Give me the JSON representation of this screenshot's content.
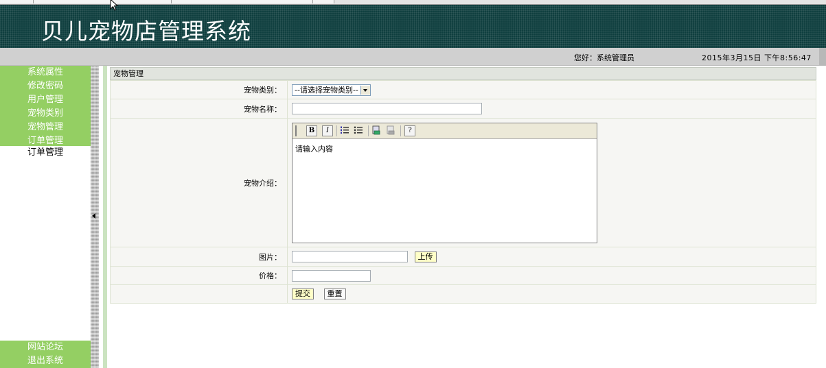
{
  "app": {
    "title": "贝儿宠物店管理系统"
  },
  "status": {
    "greeting": "您好：系统管理员",
    "datetime": "2015年3月15日 下午8:56:47"
  },
  "sidebar": {
    "items": [
      {
        "label": "系统属性"
      },
      {
        "label": "修改密码"
      },
      {
        "label": "用户管理"
      },
      {
        "label": "宠物类别"
      },
      {
        "label": "宠物管理"
      },
      {
        "label": "订单管理"
      },
      {
        "label": "订单管理"
      }
    ],
    "bottom_items": [
      {
        "label": "网站论坛"
      },
      {
        "label": "退出系统"
      }
    ]
  },
  "form": {
    "panel_title": "宠物管理",
    "category": {
      "label": "宠物类别：",
      "selected": "--请选择宠物类别--"
    },
    "name": {
      "label": "宠物名称：",
      "value": ""
    },
    "intro": {
      "label": "宠物介绍：",
      "content": "请输入内容",
      "toolbar": {
        "bold": "B",
        "italic": "I",
        "help": "?"
      },
      "toolbar_icons": [
        "bold-icon",
        "italic-icon",
        "ordered-list-icon",
        "unordered-list-icon",
        "link-icon",
        "unlink-icon",
        "help-icon"
      ]
    },
    "image": {
      "label": "图片：",
      "value": "",
      "upload_label": "上传"
    },
    "price": {
      "label": "价格：",
      "value": ""
    },
    "submit_label": "提交",
    "reset_label": "重置"
  },
  "colors": {
    "header_bg": "#0f3f3f",
    "nav_green": "#94cf63",
    "status_bar": "#d0d0d0",
    "form_bg": "#f6f6f3",
    "button_yellow": "#ffffc8"
  }
}
